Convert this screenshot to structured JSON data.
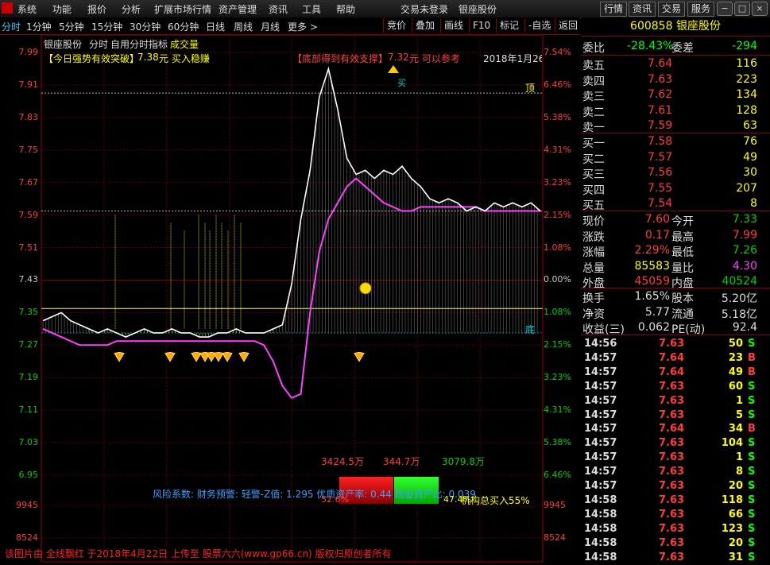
{
  "menu": {
    "items": [
      "系统",
      "功能",
      "报价",
      "分析",
      "扩展市场行情",
      "资产管理",
      "资讯",
      "工具",
      "帮助"
    ],
    "status": [
      "交易未登录",
      "银座股份"
    ],
    "right_buttons": [
      "行情",
      "资讯",
      "交易",
      "服务"
    ],
    "window_buttons": [
      "−",
      "□",
      "×"
    ]
  },
  "periods": [
    "分时",
    "1分钟",
    "5分钟",
    "15分钟",
    "30分钟",
    "60分钟",
    "日线",
    "周线",
    "月线",
    "更多 >"
  ],
  "toolbar": [
    "竞价",
    "叠加",
    "画线",
    "F10",
    "标记",
    "-自选",
    "返回"
  ],
  "chart_header": {
    "stock": "银座股份",
    "mode": "分时",
    "indicator": "自用分时指标",
    "volume": "成交量"
  },
  "annotations": {
    "left_title": "【今日强势有效突破】",
    "left_value": "7.38",
    "left_text": "元 买入稳赚",
    "mid_title": "【底部得到有效支撑】",
    "mid_value": "7.32",
    "mid_text": "元 可以参考",
    "date": "2018年1月26",
    "top_mark": "顶",
    "bottom_mark": "底",
    "buy_mark": "买"
  },
  "axis": {
    "left": [
      "7.99",
      "7.91",
      "7.83",
      "7.75",
      "7.67",
      "7.59",
      "7.51",
      "7.43",
      "7.35",
      "7.27",
      "7.19",
      "7.11",
      "7.03",
      "6.95",
      "9945",
      "8524"
    ],
    "right": [
      "7.54%",
      "6.46%",
      "5.38%",
      "4.31%",
      "3.23%",
      "2.15%",
      "1.08%",
      "0.00%",
      "1.08%",
      "2.15%",
      "3.23%",
      "4.31%",
      "5.38%",
      "6.46%",
      "9945",
      "8524"
    ]
  },
  "bottom_info": {
    "v1": "3424.5万",
    "v2": "344.7万",
    "v3": "3079.8万",
    "risk": "风险系数: 财务预警: 轻警-Z值: 1.295 优质资产率: 0.44 现金资产比: 0.039",
    "left_pct": "52.6%",
    "right_pct": "47.4%",
    "inst": "机构总买入55%"
  },
  "chart_data": {
    "type": "line",
    "ylim": [
      6.95,
      7.99
    ],
    "prev_close": 7.43,
    "series": [],
    "price": [
      7.33,
      7.34,
      7.35,
      7.33,
      7.32,
      7.31,
      7.3,
      7.31,
      7.3,
      7.29,
      7.3,
      7.31,
      7.3,
      7.3,
      7.31,
      7.3,
      7.3,
      7.29,
      7.29,
      7.3,
      7.3,
      7.31,
      7.3,
      7.3,
      7.3,
      7.31,
      7.32,
      7.42,
      7.58,
      7.7,
      7.88,
      7.95,
      7.85,
      7.73,
      7.69,
      7.7,
      7.68,
      7.7,
      7.69,
      7.71,
      7.68,
      7.66,
      7.63,
      7.62,
      7.63,
      7.62,
      7.6,
      7.61,
      7.6,
      7.62,
      7.61,
      7.62,
      7.61,
      7.62,
      7.6
    ],
    "avg": [
      7.31,
      7.3,
      7.29,
      7.28,
      7.27,
      7.27,
      7.27,
      7.27,
      7.28,
      7.28,
      7.28,
      7.28,
      7.28,
      7.28,
      7.28,
      7.28,
      7.28,
      7.28,
      7.28,
      7.28,
      7.28,
      7.28,
      7.28,
      7.28,
      7.27,
      7.23,
      7.17,
      7.14,
      7.15,
      7.35,
      7.5,
      7.58,
      7.62,
      7.66,
      7.68,
      7.66,
      7.64,
      7.62,
      7.61,
      7.6,
      7.6,
      7.61,
      7.61,
      7.61,
      7.61,
      7.61,
      7.61,
      7.61,
      7.6,
      7.6,
      7.6,
      7.6,
      7.6,
      7.6,
      7.6
    ]
  },
  "quote": {
    "code": "600858",
    "name": "银座股份",
    "wb_label": "委比",
    "wb": "-28.43%",
    "wc_label": "委差",
    "wc": "-294",
    "sells": [
      {
        "label": "卖五",
        "price": "7.64",
        "vol": "116"
      },
      {
        "label": "卖四",
        "price": "7.63",
        "vol": "223"
      },
      {
        "label": "卖三",
        "price": "7.62",
        "vol": "134"
      },
      {
        "label": "卖二",
        "price": "7.61",
        "vol": "128"
      },
      {
        "label": "卖一",
        "price": "7.59",
        "vol": "63"
      }
    ],
    "buys": [
      {
        "label": "买一",
        "price": "7.58",
        "vol": "76"
      },
      {
        "label": "买二",
        "price": "7.57",
        "vol": "49"
      },
      {
        "label": "买三",
        "price": "7.56",
        "vol": "30"
      },
      {
        "label": "买四",
        "price": "7.55",
        "vol": "207"
      },
      {
        "label": "买五",
        "price": "7.54",
        "vol": "8"
      }
    ],
    "stats": [
      {
        "l1": "现价",
        "v1": "7.60",
        "c1": "up",
        "l2": "今开",
        "v2": "7.33",
        "c2": "dn"
      },
      {
        "l1": "涨跌",
        "v1": "0.17",
        "c1": "up",
        "l2": "最高",
        "v2": "7.99",
        "c2": "up"
      },
      {
        "l1": "涨幅",
        "v1": "2.29%",
        "c1": "up",
        "l2": "最低",
        "v2": "7.26",
        "c2": "dn"
      },
      {
        "l1": "总量",
        "v1": "85583",
        "c1": "yel",
        "l2": "量比",
        "v2": "4.30",
        "c2": "mag"
      },
      {
        "l1": "外盘",
        "v1": "45059",
        "c1": "up",
        "l2": "内盘",
        "v2": "40524",
        "c2": "dn"
      }
    ],
    "fin": [
      {
        "l1": "换手",
        "v1": "1.65%",
        "l2": "股本",
        "v2": "5.20亿"
      },
      {
        "l1": "净资",
        "v1": "5.77",
        "l2": "流通",
        "v2": "5.18亿"
      },
      {
        "l1": "收益(三)",
        "v1": "0.062",
        "l2": "PE(动)",
        "v2": "92.4"
      }
    ],
    "trades": [
      {
        "t": "14:56",
        "p": "7.63",
        "v": "50",
        "s": "S"
      },
      {
        "t": "14:57",
        "p": "7.64",
        "v": "23",
        "s": "B"
      },
      {
        "t": "14:57",
        "p": "7.64",
        "v": "49",
        "s": "B"
      },
      {
        "t": "14:57",
        "p": "7.63",
        "v": "60",
        "s": "S"
      },
      {
        "t": "14:57",
        "p": "7.63",
        "v": "1",
        "s": "S"
      },
      {
        "t": "14:57",
        "p": "7.63",
        "v": "5",
        "s": "S"
      },
      {
        "t": "14:57",
        "p": "7.64",
        "v": "34",
        "s": "B"
      },
      {
        "t": "14:57",
        "p": "7.63",
        "v": "104",
        "s": "S"
      },
      {
        "t": "14:57",
        "p": "7.63",
        "v": "1",
        "s": "S"
      },
      {
        "t": "14:57",
        "p": "7.63",
        "v": "8",
        "s": "S"
      },
      {
        "t": "14:57",
        "p": "7.63",
        "v": "20",
        "s": "S"
      },
      {
        "t": "14:58",
        "p": "7.63",
        "v": "118",
        "s": "S"
      },
      {
        "t": "14:58",
        "p": "7.63",
        "v": "66",
        "s": "S"
      },
      {
        "t": "14:58",
        "p": "7.63",
        "v": "123",
        "s": "S"
      },
      {
        "t": "14:58",
        "p": "7.63",
        "v": "20",
        "s": "S"
      },
      {
        "t": "14:58",
        "p": "7.63",
        "v": "31",
        "s": "S"
      }
    ]
  },
  "footer": "该图片由 全线飘红 于2018年4月22日 上传至 股票六六(www.gp66.cn) 版权归原创者所有",
  "colors": {
    "up": "#ff3c3c",
    "down": "#00d000",
    "grid": "#800000",
    "price": "#ffffff",
    "avg": "#ff40ff"
  }
}
